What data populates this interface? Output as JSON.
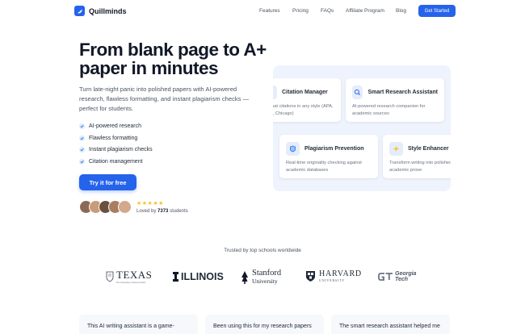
{
  "nav": {
    "brand": "Quillminds",
    "links": [
      "Features",
      "Pricing",
      "FAQs",
      "Affiliate Program",
      "Blog"
    ],
    "cta": "Get Started"
  },
  "hero": {
    "title": "From blank page to A+ paper in minutes",
    "subtitle": "Turn late-night panic into polished papers with AI-powered research, flawless formatting, and instant plagiarism checks — perfect for students.",
    "features": [
      "AI-powered research",
      "Flawless formatting",
      "Instant plagiarism checks",
      "Citation management"
    ],
    "cta": "Try it for free",
    "stars": "★★★★★",
    "loved_prefix": "Loved by",
    "loved_count": "7373",
    "loved_suffix": "students"
  },
  "feature_cards": [
    {
      "title": "Citation Manager",
      "desc_lines": [
        "Format citations in any style (APA,",
        "MLA, Chicago)"
      ],
      "icon": "book-icon"
    },
    {
      "title": "Smart Research Assistant",
      "desc_lines": [
        "AI-powered research companion for",
        "academic sources"
      ],
      "icon": "magnifier-icon"
    },
    {
      "title": "Plagiarism Prevention",
      "desc_lines": [
        "Real-time originality checking against",
        "academic databases"
      ],
      "icon": "shield-icon"
    },
    {
      "title": "Style Enhancer",
      "desc_lines": [
        "Transform writing into polished",
        "academic prose"
      ],
      "icon": "sparkle-icon"
    }
  ],
  "trusted": {
    "heading": "Trusted by top schools worldwide",
    "texas": "TEXAS",
    "texas_sub": "The University of Texas at Austin",
    "illinois": "ILLINOIS",
    "stanford_1": "Stanford",
    "stanford_2": "University",
    "harvard_1": "HARVARD",
    "harvard_2": "UNIVERSITY",
    "gt_1": "Georgia",
    "gt_2": "Tech"
  },
  "testimonials": [
    "This AI writing assistant is a game-",
    "Been using this for my research papers",
    "The smart research assistant helped me"
  ],
  "colors": {
    "accent": "#2563eb",
    "panel": "#eef3fd",
    "star": "#fbbf24"
  }
}
